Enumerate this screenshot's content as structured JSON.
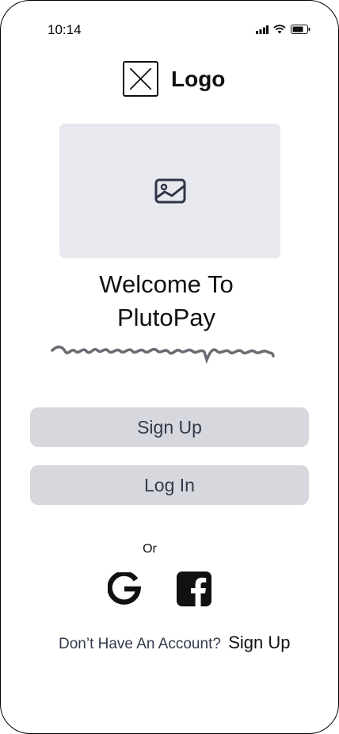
{
  "status_bar": {
    "time": "10:14"
  },
  "brand": {
    "logo_text": "Logo"
  },
  "hero": {
    "icon": "image-icon"
  },
  "welcome": {
    "line1": "Welcome To",
    "line2": "PlutoPay"
  },
  "buttons": {
    "sign_up": "Sign Up",
    "log_in": "Log In"
  },
  "divider": {
    "or_text": "Or"
  },
  "social": {
    "google_icon": "google-icon",
    "facebook_icon": "facebook-icon"
  },
  "footer": {
    "prompt": "Don’t Have An Account?",
    "link": "Sign Up"
  },
  "colors": {
    "button_bg": "#d7d7de",
    "button_text": "#333a4b",
    "hero_bg": "#e7e9ee",
    "scribble": "#6b6b73"
  }
}
